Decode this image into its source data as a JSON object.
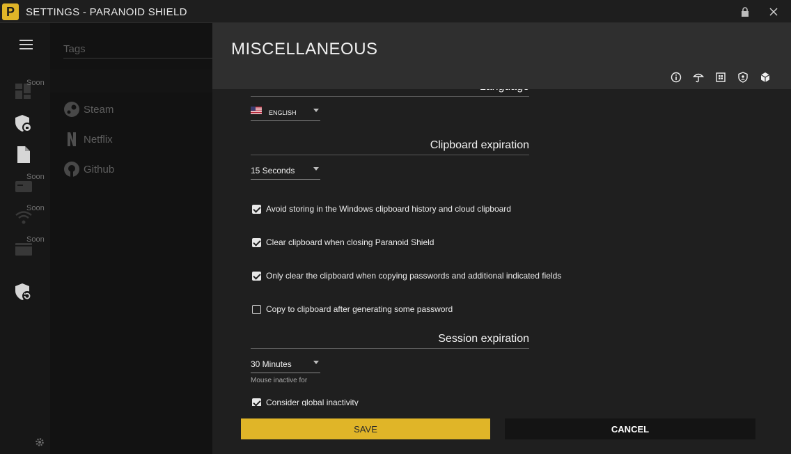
{
  "window": {
    "title": "SETTINGS - PARANOID SHIELD",
    "logo_letter": "P"
  },
  "colors": {
    "accent": "#e0b528",
    "header_bg": "#2f2f2f",
    "content_bg": "#1f1f1f"
  },
  "rail": {
    "soon_label": "Soon"
  },
  "list": {
    "search_placeholder": "Tags",
    "items": [
      {
        "label": "Steam",
        "icon": "steam-icon"
      },
      {
        "label": "Netflix",
        "icon": "netflix-icon"
      },
      {
        "label": "Github",
        "icon": "github-icon"
      }
    ]
  },
  "header": {
    "title": "MISCELLANEOUS"
  },
  "settings": {
    "language": {
      "section": "Language",
      "value": "ENGLISH"
    },
    "clipboard": {
      "section": "Clipboard expiration",
      "value": "15 Seconds",
      "options": [
        {
          "label": "Avoid storing in the Windows clipboard history and cloud clipboard",
          "checked": true
        },
        {
          "label": "Clear clipboard when closing Paranoid Shield",
          "checked": true
        },
        {
          "label": "Only clear the clipboard when copying passwords and additional indicated fields",
          "checked": true
        },
        {
          "label": "Copy to clipboard after generating some password",
          "checked": false
        }
      ]
    },
    "session": {
      "section": "Session expiration",
      "value": "30 Minutes",
      "helper": "Mouse inactive for",
      "global_label": "Consider global inactivity",
      "global_checked": true
    }
  },
  "footer": {
    "save_label": "SAVE",
    "cancel_label": "CANCEL"
  }
}
